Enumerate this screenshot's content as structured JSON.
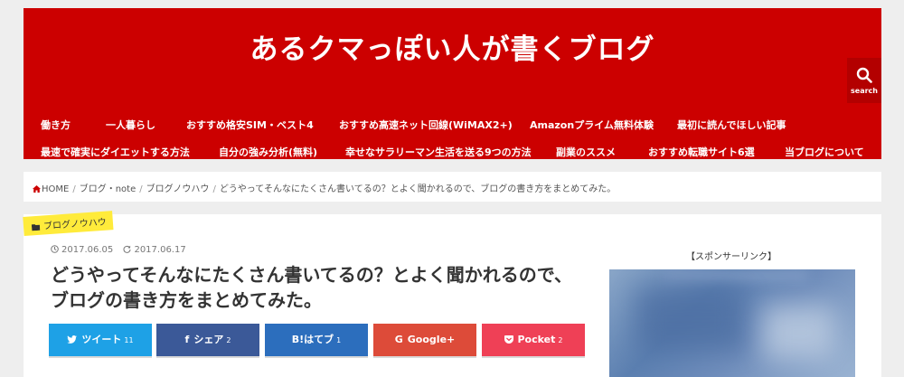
{
  "header": {
    "site_title": "あるクマっぽい人が書くブログ",
    "search_label": "search",
    "nav_row_1": [
      "働き方",
      "一人暮らし",
      "おすすめ格安SIM・ベスト4",
      "おすすめ高速ネット回線(WiMAX2+)",
      "Amazonプライム無料体験",
      "最初に読んでほしい記事"
    ],
    "nav_row_2": [
      "最速で確実にダイエットする方法",
      "自分の強み分析(無料)",
      "幸せなサラリーマン生活を送る9つの方法",
      "副業のススメ",
      "おすすめ転職サイト6選",
      "当ブログについて"
    ]
  },
  "breadcrumb": {
    "home": "HOME",
    "items": [
      "ブログ・note",
      "ブログノウハウ",
      "どうやってそんなにたくさん書いてるの？とよく聞かれるので、ブログの書き方をまとめてみた。"
    ]
  },
  "article": {
    "category": "ブログノウハウ",
    "published": "2017.06.05",
    "updated": "2017.06.17",
    "title_line_1": "どうやってそんなにたくさん書いてるの？とよく聞かれるので、",
    "title_line_2": "ブログの書き方をまとめてみた。"
  },
  "share": {
    "twitter": {
      "label": "ツイート",
      "count": "11"
    },
    "facebook": {
      "label": "シェア",
      "count": "2"
    },
    "hatena": {
      "label": "B!はてブ",
      "count": "1"
    },
    "google": {
      "label": "Google+",
      "count": ""
    },
    "pocket": {
      "label": "Pocket",
      "count": "2"
    }
  },
  "sidebar": {
    "sponsor_label": "【スポンサーリンク】"
  },
  "colors": {
    "header_red": "#cc0000",
    "tag_yellow": "#ffeb3b",
    "twitter": "#1ea1e6",
    "facebook": "#3b5998",
    "hatena": "#2c6ebd",
    "google": "#dd4b39",
    "pocket": "#ef4056"
  },
  "icons": [
    "search-icon",
    "home-icon",
    "folder-icon",
    "clock-icon",
    "update-icon",
    "twitter-icon",
    "facebook-icon",
    "hatena-icon",
    "google-plus-icon",
    "pocket-icon"
  ]
}
